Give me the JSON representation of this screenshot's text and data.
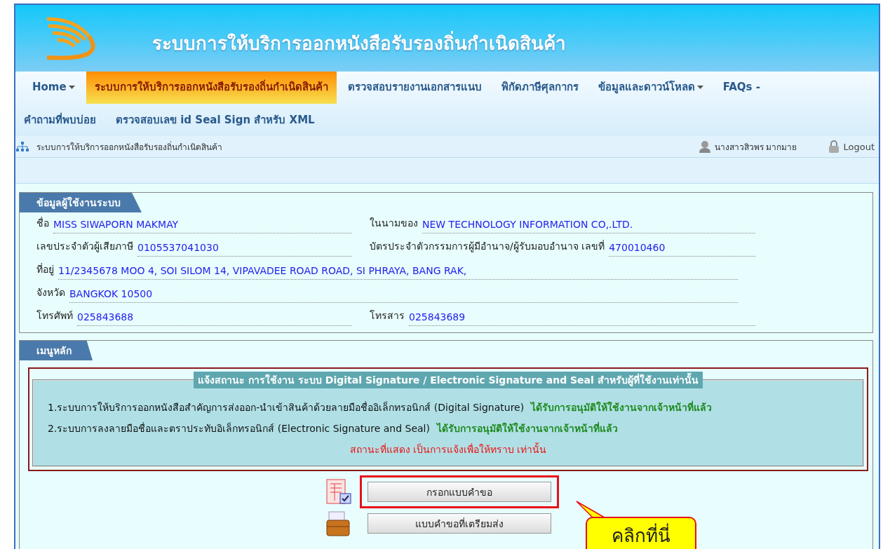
{
  "header": {
    "title": "ระบบการให้บริการออกหนังสือรับรองถิ่นกำเนิดสินค้า"
  },
  "nav": {
    "row_1": [
      {
        "label": "Home",
        "dropdown": true,
        "selected": false
      },
      {
        "label": "ระบบการให้บริการออกหนังสือรับรองถิ่นกำเนิดสินค้า",
        "dropdown": false,
        "selected": true
      },
      {
        "label": "ตรวจสอบรายงานเอกสารแนบ",
        "dropdown": false,
        "selected": false
      },
      {
        "label": "พิกัดภาษีศุลกากร",
        "dropdown": false,
        "selected": false
      },
      {
        "label": "ข้อมูลและดาวน์โหลด",
        "dropdown": true,
        "selected": false
      },
      {
        "label": "FAQs -",
        "dropdown": false,
        "selected": false
      }
    ],
    "row_2": [
      {
        "label": "คำถามที่พบบ่อย",
        "dropdown": false,
        "selected": false
      },
      {
        "label": "ตรวจสอบเลข id Seal Sign สำหรับ XML",
        "dropdown": false,
        "selected": false
      }
    ]
  },
  "breadcrumb": "ระบบการให้บริการออกหนังสือรับรองถิ่นกำเนิดสินค้า",
  "user": {
    "name": "นางสาวสิวพร มากมาย",
    "logout": "Logout"
  },
  "user_info": {
    "title": "ข้อมูลผู้ใช้งานระบบ",
    "rows": [
      [
        {
          "label": "ชื่อ",
          "value": "MISS SIWAPORN MAKMAY"
        },
        {
          "label": "ในนามของ",
          "value": "NEW TECHNOLOGY INFORMATION CO,.LTD."
        }
      ],
      [
        {
          "label": "เลขประจำตัวผู้เสียภาษี",
          "value": "0105537041030"
        },
        {
          "label": "บัตรประจำตัวกรรมการผู้มีอำนาจ/ผู้รับมอบอำนาจ เลขที่",
          "value": "470010460"
        }
      ],
      [
        {
          "label": "ที่อยู่",
          "value": "11/2345678 MOO 4, SOI SILOM 14, VIPAVADEE ROAD ROAD, SI PHRAYA, BANG RAK,"
        }
      ],
      [
        {
          "label": "จังหวัด",
          "value": "BANGKOK 10500"
        }
      ],
      [
        {
          "label": "โทรศัพท์",
          "value": "025843688"
        },
        {
          "label": "โทรสาร",
          "value": "025843689"
        }
      ]
    ]
  },
  "main_menu": {
    "title": "เมนูหลัก",
    "notice": {
      "legend": "แจ้งสถานะ การใช้งาน ระบบ Digital Signature / Electronic Signature and Seal สำหรับผู้ที่ใช้งานเท่านั้น",
      "items": [
        {
          "text": "1.ระบบการให้บริการออกหนังสือสำคัญการส่งออก-นำเข้าสินค้าด้วยลายมือชื่ออิเล็กทรอนิกส์ (Digital Signature)",
          "status": "ได้รับการอนุมัติให้ใช้งานจากเจ้าหน้าที่แล้ว"
        },
        {
          "text": "2.ระบบการลงลายมือชื่อและตราประทับอิเล็กทรอนิกส์ (Electronic Signature and Seal)",
          "status": "ได้รับการอนุมัติให้ใช้งานจากเจ้าหน้าที่แล้ว"
        }
      ],
      "footnote": "สถานะที่แสดง เป็นการแจ้งเพื่อให้ทราบ เท่านั้น"
    },
    "buttons": [
      {
        "label": "กรอกแบบคำขอ",
        "kind": "form",
        "highlighted": true
      },
      {
        "label": "แบบคำขอที่เตรียมส่ง",
        "kind": "package",
        "highlighted": false
      }
    ],
    "callout": "คลิกที่นี่"
  }
}
